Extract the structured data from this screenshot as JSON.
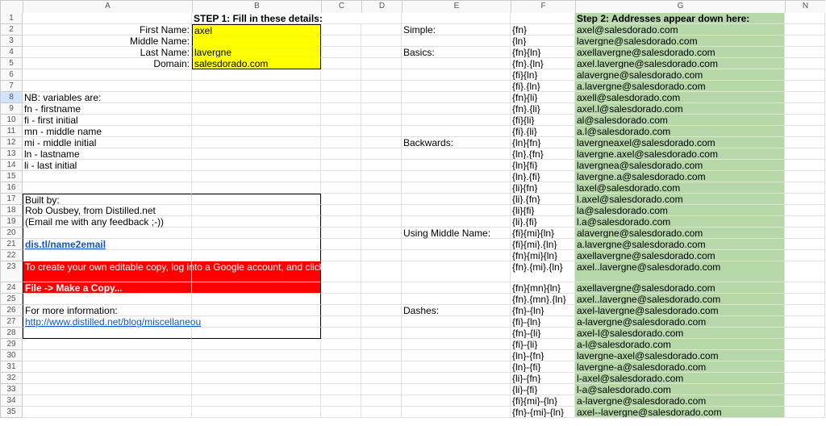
{
  "columns": [
    "A",
    "B",
    "C",
    "D",
    "E",
    "F",
    "G",
    "N"
  ],
  "row_count": 35,
  "selected_row": 8,
  "step1_label": "STEP 1: Fill in these details:",
  "step2_label": "Step 2: Addresses appear down here:",
  "form": {
    "first_name_label": "First Name:",
    "first_name_value": "axel",
    "middle_name_label": "Middle Name:",
    "middle_name_value": "",
    "last_name_label": "Last Name:",
    "last_name_value": "lavergne",
    "domain_label": "Domain:",
    "domain_value": "salesdorado.com"
  },
  "notes": {
    "nb_title": "NB: variables are:",
    "nb_lines": [
      "fn - firstname",
      "fi - first initial",
      "mn - middle name",
      "mi - middle initial",
      "ln - lastname",
      "li - last initial"
    ],
    "built_by_title": "Built by:",
    "built_by_name": "Rob Ousbey, from Distilled.net",
    "built_by_email": "(Email me with any feedback ;-))",
    "shortlink": "dis.tl/name2email",
    "copy_instructions_line1": "To create your own editable copy, log into a Google account, and click:",
    "copy_instructions_line2": "File -> Make a Copy...",
    "more_info_label": "For more information:",
    "more_info_link": "http://www.distilled.net/blog/miscellaneou"
  },
  "sections": {
    "simple": "Simple:",
    "basics": "Basics:",
    "backwards": "Backwards:",
    "middle": "Using Middle Name:",
    "dashes": "Dashes:"
  },
  "rows": [
    {
      "r": 2,
      "sec": "simple",
      "pat": "{fn}",
      "addr": "axel@salesdorado.com"
    },
    {
      "r": 3,
      "pat": "{ln}",
      "addr": "lavergne@salesdorado.com"
    },
    {
      "r": 4,
      "sec": "basics",
      "pat": "{fn}{ln}",
      "addr": "axellavergne@salesdorado.com"
    },
    {
      "r": 5,
      "pat": "{fn}.{ln}",
      "addr": "axel.lavergne@salesdorado.com"
    },
    {
      "r": 6,
      "pat": "{fi}{ln}",
      "addr": "alavergne@salesdorado.com"
    },
    {
      "r": 7,
      "pat": "{fi}.{ln}",
      "addr": "a.lavergne@salesdorado.com"
    },
    {
      "r": 8,
      "pat": "{fn}{li}",
      "addr": "axell@salesdorado.com"
    },
    {
      "r": 9,
      "pat": "{fn}.{li}",
      "addr": "axel.l@salesdorado.com"
    },
    {
      "r": 10,
      "pat": "{fi}{li}",
      "addr": "al@salesdorado.com"
    },
    {
      "r": 11,
      "pat": "{fi}.{li}",
      "addr": "a.l@salesdorado.com"
    },
    {
      "r": 12,
      "sec": "backwards",
      "pat": "{ln}{fn}",
      "addr": "lavergneaxel@salesdorado.com"
    },
    {
      "r": 13,
      "pat": "{ln}.{fn}",
      "addr": "lavergne.axel@salesdorado.com"
    },
    {
      "r": 14,
      "pat": "{ln}{fi}",
      "addr": "lavergnea@salesdorado.com"
    },
    {
      "r": 15,
      "pat": "{ln}.{fi}",
      "addr": "lavergne.a@salesdorado.com"
    },
    {
      "r": 16,
      "pat": "{li}{fn}",
      "addr": "laxel@salesdorado.com"
    },
    {
      "r": 17,
      "pat": "{li}.{fn}",
      "addr": "l.axel@salesdorado.com"
    },
    {
      "r": 18,
      "pat": "{li}{fi}",
      "addr": "la@salesdorado.com"
    },
    {
      "r": 19,
      "pat": "{li}.{fi}",
      "addr": "l.a@salesdorado.com"
    },
    {
      "r": 20,
      "sec": "middle",
      "pat": "{fi}{mi}{ln}",
      "addr": "alavergne@salesdorado.com"
    },
    {
      "r": 21,
      "pat": "{fi}{mi}.{ln}",
      "addr": "a.lavergne@salesdorado.com"
    },
    {
      "r": 22,
      "pat": "{fn}{mi}{ln}",
      "addr": "axellavergne@salesdorado.com"
    },
    {
      "r": 23,
      "pat": "{fn}.{mi}.{ln}",
      "addr": "axel..lavergne@salesdorado.com"
    },
    {
      "r": 24,
      "pat": "{fn}{mn}{ln}",
      "addr": "axellavergne@salesdorado.com"
    },
    {
      "r": 25,
      "pat": "{fn}.{mn}.{ln}",
      "addr": "axel..lavergne@salesdorado.com"
    },
    {
      "r": 26,
      "sec": "dashes",
      "pat": "{fn}-{ln}",
      "addr": "axel-lavergne@salesdorado.com"
    },
    {
      "r": 27,
      "pat": "{fi}-{ln}",
      "addr": "a-lavergne@salesdorado.com"
    },
    {
      "r": 28,
      "pat": "{fn}-{li}",
      "addr": "axel-l@salesdorado.com"
    },
    {
      "r": 29,
      "pat": "{fi}-{li}",
      "addr": "a-l@salesdorado.com"
    },
    {
      "r": 30,
      "pat": "{ln}-{fn}",
      "addr": "lavergne-axel@salesdorado.com"
    },
    {
      "r": 31,
      "pat": "{ln}-{fi}",
      "addr": "lavergne-a@salesdorado.com"
    },
    {
      "r": 32,
      "pat": "{li}-{fn}",
      "addr": "l-axel@salesdorado.com"
    },
    {
      "r": 33,
      "pat": "{li}-{fi}",
      "addr": "l-a@salesdorado.com"
    },
    {
      "r": 34,
      "pat": "{fi}{mi}-{ln}",
      "addr": "a-lavergne@salesdorado.com"
    },
    {
      "r": 35,
      "pat": "{fn}-{mi}-{ln}",
      "addr": "axel--lavergne@salesdorado.com"
    }
  ]
}
